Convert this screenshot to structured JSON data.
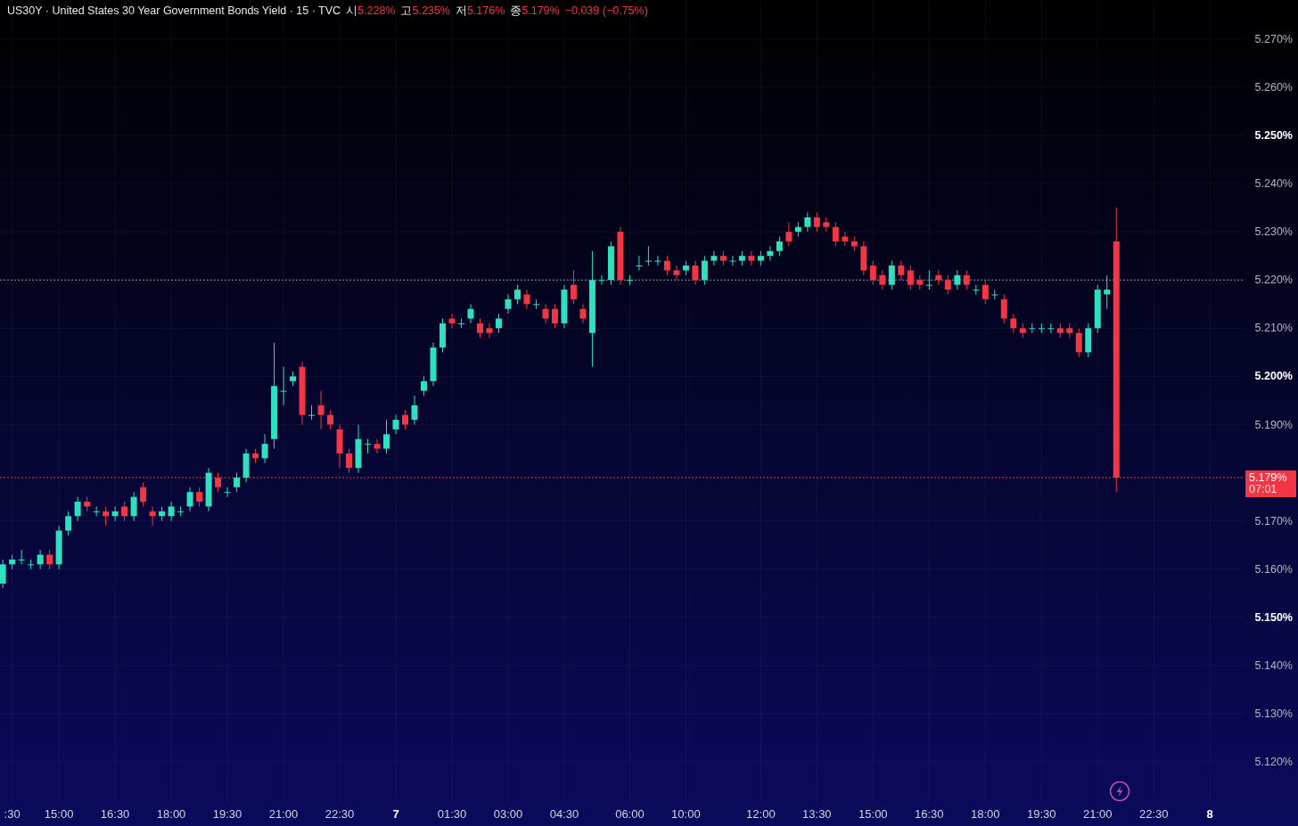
{
  "header": {
    "title": "US30Y · United States 30 Year Government Bonds Yield · 15 · TVC",
    "ohlc": [
      {
        "label": "시",
        "value": "5.228%"
      },
      {
        "label": "고",
        "value": "5.235%"
      },
      {
        "label": "저",
        "value": "5.176%"
      },
      {
        "label": "종",
        "value": "5.179%"
      }
    ],
    "change": "−0.039 (−0.75%)"
  },
  "chart": {
    "chart_data": {
      "type": "candlestick",
      "grid": true,
      "categories": [
        null,
        ":30",
        null,
        null,
        null,
        null,
        "15:00",
        null,
        null,
        null,
        null,
        null,
        "16:30",
        null,
        null,
        null,
        null,
        null,
        "18:00",
        null,
        null,
        null,
        null,
        null,
        "19:30",
        null,
        null,
        null,
        null,
        null,
        "21:00",
        null,
        null,
        null,
        null,
        null,
        "22:30",
        null,
        null,
        null,
        null,
        null,
        "7",
        null,
        null,
        null,
        null,
        null,
        "01:30",
        null,
        null,
        null,
        null,
        null,
        "03:00",
        null,
        null,
        null,
        null,
        null,
        "04:30",
        null,
        null,
        null,
        null,
        null,
        null,
        "06:00",
        null,
        null,
        null,
        null,
        null,
        "10:00",
        null,
        null,
        null,
        null,
        null,
        null,
        null,
        "12:00",
        null,
        null,
        null,
        null,
        null,
        "13:30",
        null,
        null,
        null,
        null,
        null,
        "15:00",
        null,
        null,
        null,
        null,
        null,
        "16:30",
        null,
        null,
        null,
        null,
        null,
        "18:00",
        null,
        null,
        null,
        null,
        null,
        "19:30",
        null,
        null,
        null,
        null,
        null,
        "21:00",
        null,
        null,
        null,
        null,
        null,
        "22:30",
        null,
        null,
        null,
        null,
        null,
        "8"
      ],
      "ohlc": [
        [
          5.157,
          5.162,
          5.156,
          5.161
        ],
        [
          5.161,
          5.163,
          5.16,
          5.162
        ],
        [
          5.162,
          5.164,
          5.161,
          5.162
        ],
        [
          5.161,
          5.162,
          5.16,
          5.161
        ],
        [
          5.161,
          5.164,
          5.16,
          5.163
        ],
        [
          5.163,
          5.164,
          5.16,
          5.161
        ],
        [
          5.161,
          5.169,
          5.16,
          5.168
        ],
        [
          5.168,
          5.172,
          5.167,
          5.171
        ],
        [
          5.171,
          5.175,
          5.17,
          5.174
        ],
        [
          5.174,
          5.175,
          5.172,
          5.173
        ],
        [
          5.172,
          5.173,
          5.171,
          5.172
        ],
        [
          5.172,
          5.173,
          5.169,
          5.171
        ],
        [
          5.171,
          5.173,
          5.17,
          5.172
        ],
        [
          5.173,
          5.174,
          5.17,
          5.171
        ],
        [
          5.171,
          5.176,
          5.17,
          5.175
        ],
        [
          5.177,
          5.178,
          5.173,
          5.174
        ],
        [
          5.172,
          5.173,
          5.169,
          5.171
        ],
        [
          5.171,
          5.173,
          5.17,
          5.172
        ],
        [
          5.171,
          5.174,
          5.17,
          5.173
        ],
        [
          5.172,
          5.173,
          5.171,
          5.172
        ],
        [
          5.173,
          5.177,
          5.172,
          5.176
        ],
        [
          5.176,
          5.177,
          5.173,
          5.174
        ],
        [
          5.173,
          5.181,
          5.172,
          5.18
        ],
        [
          5.179,
          5.18,
          5.176,
          5.177
        ],
        [
          5.176,
          5.177,
          5.175,
          5.176
        ],
        [
          5.177,
          5.18,
          5.176,
          5.179
        ],
        [
          5.179,
          5.185,
          5.178,
          5.184
        ],
        [
          5.184,
          5.185,
          5.182,
          5.183
        ],
        [
          5.183,
          5.188,
          5.182,
          5.186
        ],
        [
          5.187,
          5.207,
          5.185,
          5.198
        ],
        [
          5.197,
          5.202,
          5.194,
          5.197
        ],
        [
          5.199,
          5.201,
          5.198,
          5.2
        ],
        [
          5.202,
          5.203,
          5.19,
          5.192
        ],
        [
          5.192,
          5.194,
          5.191,
          5.192
        ],
        [
          5.194,
          5.197,
          5.189,
          5.192
        ],
        [
          5.192,
          5.193,
          5.189,
          5.19
        ],
        [
          5.189,
          5.19,
          5.181,
          5.184
        ],
        [
          5.184,
          5.185,
          5.18,
          5.181
        ],
        [
          5.181,
          5.19,
          5.18,
          5.187
        ],
        [
          5.186,
          5.187,
          5.184,
          5.186
        ],
        [
          5.186,
          5.187,
          5.184,
          5.185
        ],
        [
          5.185,
          5.191,
          5.184,
          5.188
        ],
        [
          5.189,
          5.192,
          5.188,
          5.191
        ],
        [
          5.192,
          5.193,
          5.189,
          5.19
        ],
        [
          5.191,
          5.196,
          5.19,
          5.194
        ],
        [
          5.197,
          5.2,
          5.196,
          5.199
        ],
        [
          5.199,
          5.207,
          5.198,
          5.206
        ],
        [
          5.206,
          5.212,
          5.205,
          5.211
        ],
        [
          5.212,
          5.213,
          5.21,
          5.211
        ],
        [
          5.211,
          5.212,
          5.21,
          5.211
        ],
        [
          5.212,
          5.215,
          5.211,
          5.214
        ],
        [
          5.211,
          5.212,
          5.208,
          5.209
        ],
        [
          5.21,
          5.211,
          5.208,
          5.209
        ],
        [
          5.21,
          5.213,
          5.209,
          5.212
        ],
        [
          5.214,
          5.217,
          5.213,
          5.216
        ],
        [
          5.216,
          5.219,
          5.215,
          5.218
        ],
        [
          5.217,
          5.218,
          5.214,
          5.215
        ],
        [
          5.215,
          5.216,
          5.214,
          5.215
        ],
        [
          5.214,
          5.215,
          5.211,
          5.212
        ],
        [
          5.214,
          5.215,
          5.21,
          5.211
        ],
        [
          5.211,
          5.219,
          5.21,
          5.218
        ],
        [
          5.219,
          5.222,
          5.215,
          5.216
        ],
        [
          5.214,
          5.215,
          5.211,
          5.212
        ],
        [
          5.209,
          5.226,
          5.202,
          5.22
        ],
        [
          5.22,
          5.221,
          5.219,
          5.22
        ],
        [
          5.22,
          5.228,
          5.219,
          5.227
        ],
        [
          5.23,
          5.231,
          5.219,
          5.22
        ],
        [
          5.22,
          5.221,
          5.219,
          5.22
        ],
        [
          5.223,
          5.225,
          5.222,
          5.223
        ],
        [
          5.224,
          5.227,
          5.223,
          5.224
        ],
        [
          5.224,
          5.225,
          5.223,
          5.224
        ],
        [
          5.224,
          5.225,
          5.221,
          5.222
        ],
        [
          5.222,
          5.223,
          5.22,
          5.221
        ],
        [
          5.222,
          5.224,
          5.221,
          5.223
        ],
        [
          5.223,
          5.224,
          5.219,
          5.22
        ],
        [
          5.22,
          5.225,
          5.219,
          5.224
        ],
        [
          5.224,
          5.226,
          5.223,
          5.225
        ],
        [
          5.225,
          5.226,
          5.223,
          5.224
        ],
        [
          5.224,
          5.225,
          5.223,
          5.224
        ],
        [
          5.224,
          5.226,
          5.223,
          5.225
        ],
        [
          5.225,
          5.226,
          5.223,
          5.224
        ],
        [
          5.224,
          5.226,
          5.223,
          5.225
        ],
        [
          5.225,
          5.227,
          5.224,
          5.226
        ],
        [
          5.226,
          5.229,
          5.225,
          5.228
        ],
        [
          5.23,
          5.232,
          5.227,
          5.228
        ],
        [
          5.23,
          5.232,
          5.229,
          5.231
        ],
        [
          5.231,
          5.234,
          5.23,
          5.233
        ],
        [
          5.233,
          5.234,
          5.23,
          5.231
        ],
        [
          5.232,
          5.233,
          5.23,
          5.231
        ],
        [
          5.231,
          5.232,
          5.227,
          5.228
        ],
        [
          5.229,
          5.23,
          5.227,
          5.228
        ],
        [
          5.228,
          5.229,
          5.226,
          5.227
        ],
        [
          5.227,
          5.228,
          5.221,
          5.222
        ],
        [
          5.223,
          5.224,
          5.219,
          5.22
        ],
        [
          5.221,
          5.222,
          5.218,
          5.219
        ],
        [
          5.219,
          5.224,
          5.218,
          5.223
        ],
        [
          5.223,
          5.224,
          5.22,
          5.221
        ],
        [
          5.222,
          5.223,
          5.218,
          5.219
        ],
        [
          5.22,
          5.221,
          5.218,
          5.219
        ],
        [
          5.219,
          5.222,
          5.218,
          5.219
        ],
        [
          5.221,
          5.222,
          5.219,
          5.22
        ],
        [
          5.22,
          5.221,
          5.217,
          5.218
        ],
        [
          5.219,
          5.222,
          5.218,
          5.221
        ],
        [
          5.221,
          5.222,
          5.218,
          5.219
        ],
        [
          5.218,
          5.219,
          5.217,
          5.218
        ],
        [
          5.219,
          5.22,
          5.215,
          5.216
        ],
        [
          5.217,
          5.218,
          5.216,
          5.217
        ],
        [
          5.216,
          5.217,
          5.211,
          5.212
        ],
        [
          5.212,
          5.213,
          5.209,
          5.21
        ],
        [
          5.21,
          5.211,
          5.208,
          5.209
        ],
        [
          5.21,
          5.211,
          5.209,
          5.21
        ],
        [
          5.21,
          5.211,
          5.209,
          5.21
        ],
        [
          5.21,
          5.211,
          5.209,
          5.21
        ],
        [
          5.21,
          5.211,
          5.208,
          5.209
        ],
        [
          5.21,
          5.211,
          5.208,
          5.209
        ],
        [
          5.209,
          5.21,
          5.204,
          5.205
        ],
        [
          5.205,
          5.211,
          5.204,
          5.21
        ],
        [
          5.21,
          5.219,
          5.209,
          5.218
        ],
        [
          5.217,
          5.221,
          5.214,
          5.218
        ],
        [
          5.228,
          5.235,
          5.176,
          5.179
        ],
        null,
        null,
        null,
        null,
        null,
        null,
        null,
        null,
        null,
        null
      ],
      "ylim": [
        5.1117,
        5.2781
      ],
      "yticks": [
        {
          "value": 5.27,
          "label": "5.270%"
        },
        {
          "value": 5.26,
          "label": "5.260%"
        },
        {
          "value": 5.25,
          "label": "5.250%"
        },
        {
          "value": 5.24,
          "label": "5.240%"
        },
        {
          "value": 5.23,
          "label": "5.230%"
        },
        {
          "value": 5.22,
          "label": "5.220%"
        },
        {
          "value": 5.21,
          "label": "5.210%"
        },
        {
          "value": 5.2,
          "label": "5.200%"
        },
        {
          "value": 5.19,
          "label": "5.190%"
        },
        {
          "value": 5.17,
          "label": "5.170%"
        },
        {
          "value": 5.16,
          "label": "5.160%"
        },
        {
          "value": 5.15,
          "label": "5.150%"
        },
        {
          "value": 5.14,
          "label": "5.140%"
        },
        {
          "value": 5.13,
          "label": "5.130%"
        },
        {
          "value": 5.12,
          "label": "5.120%"
        }
      ],
      "ref_lines": [
        {
          "axis": "y",
          "value": 5.22
        },
        {
          "axis": "y",
          "value": 5.179
        }
      ]
    },
    "price_tag": {
      "value": "5.179%",
      "countdown": "07:01"
    }
  }
}
